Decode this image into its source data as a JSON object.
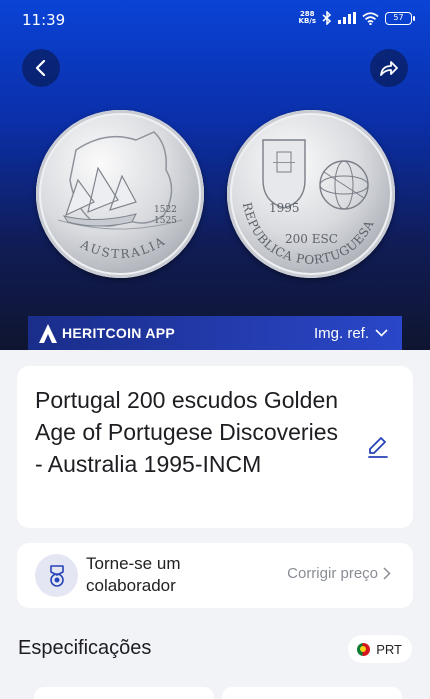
{
  "status_bar": {
    "time": "11:39",
    "net_speed_value": "288",
    "net_speed_unit": "KB/s",
    "battery_level": "57"
  },
  "hero": {
    "coin_obverse": {
      "country_text": "AUSTRALIA",
      "years": "1522\n1525"
    },
    "coin_reverse": {
      "year": "1995",
      "value": "200 ESC",
      "legend": "REPUBLICA PORTUGUESA"
    },
    "brand_name": "HERITCOIN APP",
    "img_ref_label": "Img. ref."
  },
  "coin_title": "Portugal 200 escudos Golden Age of Portugese Discoveries - Australia 1995-INCM",
  "collaborator": {
    "label": "Torne-se um colaborador",
    "action_label": "Corrigir preço"
  },
  "specs": {
    "title": "Especificações",
    "country_code": "PRT"
  },
  "colors": {
    "hero_top": "#0a43d6",
    "hero_bottom": "#0f1530",
    "accent": "#2743b8",
    "card_bg": "#ffffff",
    "page_bg": "#f2f3f7"
  },
  "icons": [
    "back-icon",
    "share-icon",
    "heritcoin-logo-icon",
    "chevron-down-icon",
    "edit-icon",
    "medal-icon",
    "chevron-right-icon",
    "portugal-flag-icon",
    "wifi-icon",
    "bluetooth-icon",
    "signal-icon",
    "battery-icon"
  ]
}
